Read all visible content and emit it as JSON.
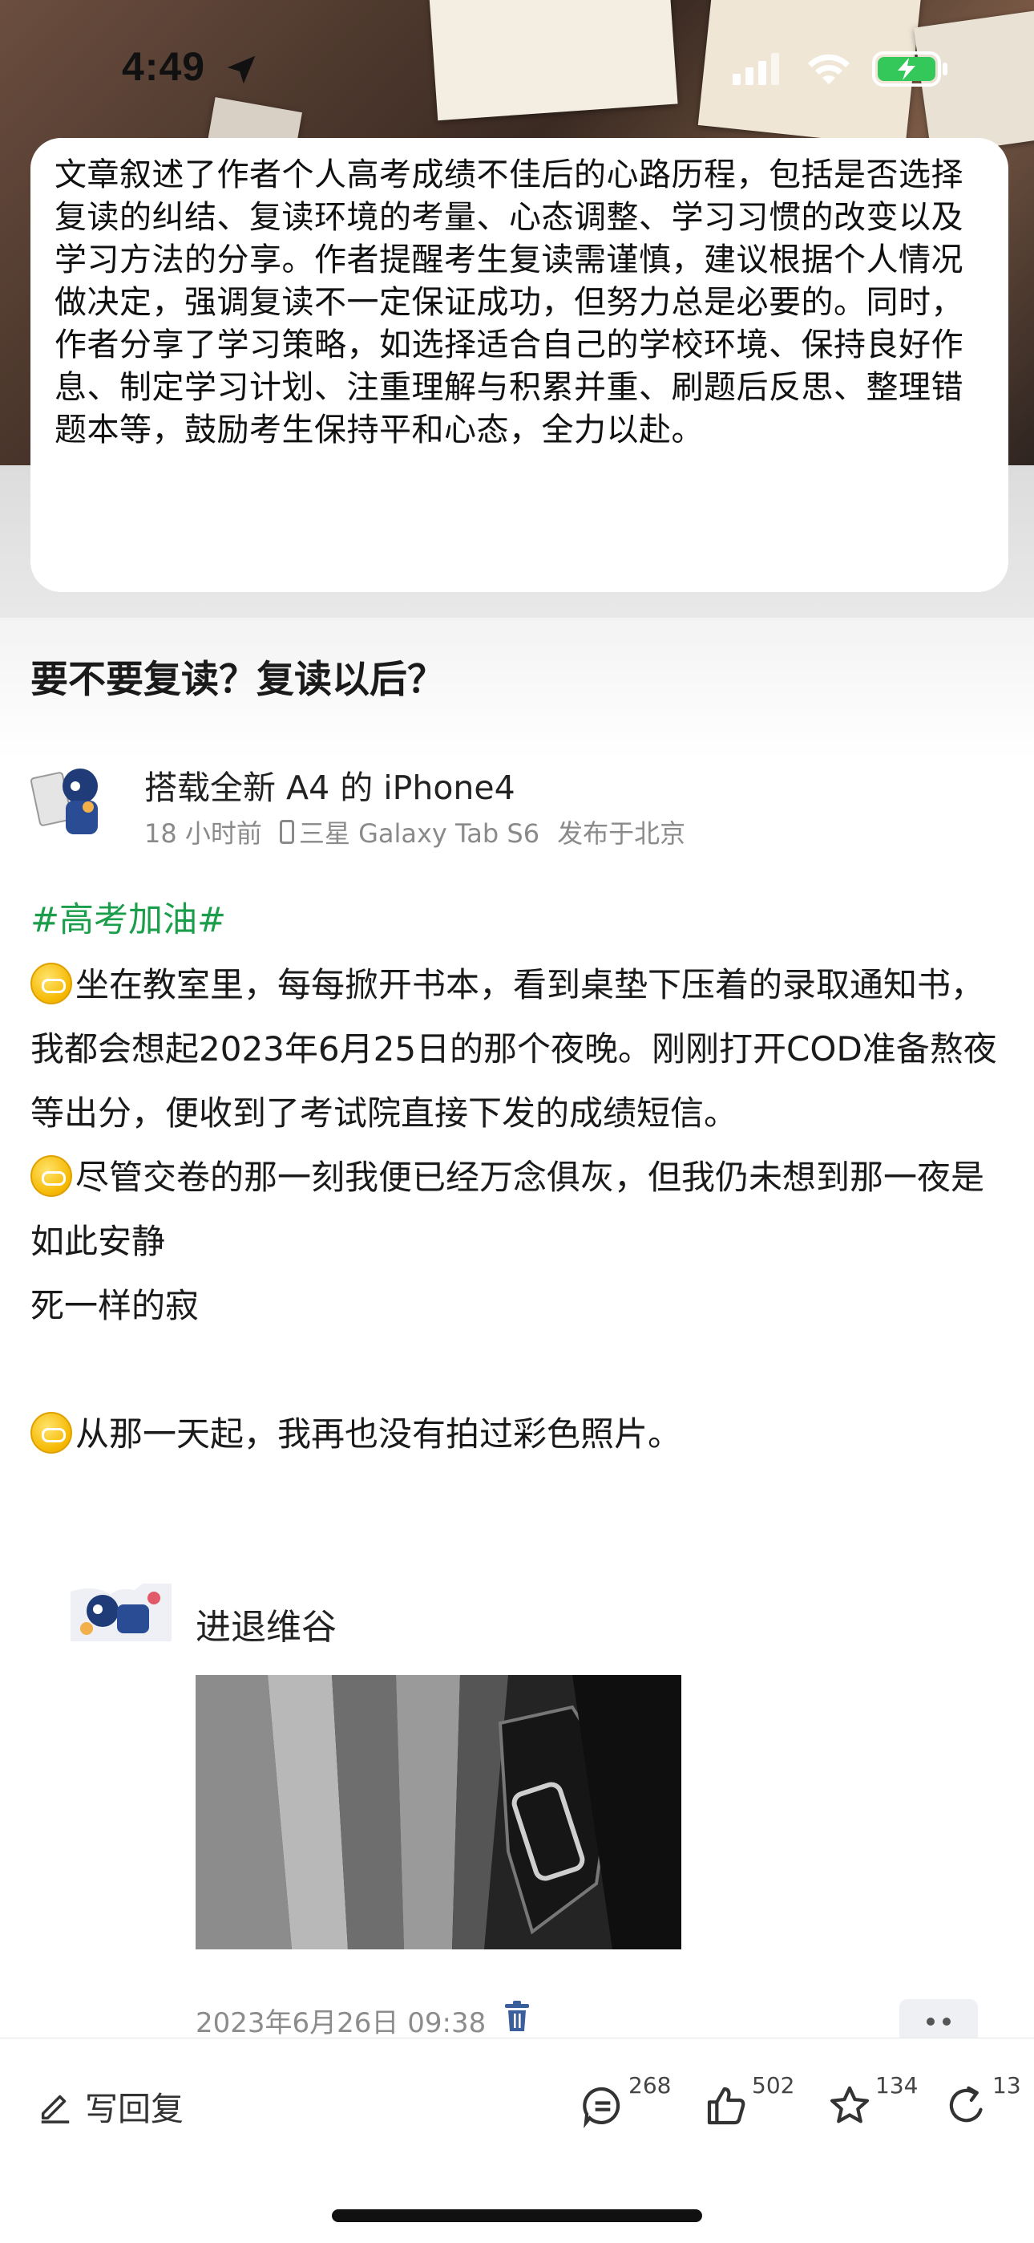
{
  "status_bar": {
    "time": "4:49"
  },
  "summary": {
    "text": "文章叙述了作者个人高考成绩不佳后的心路历程，包括是否选择复读的纠结、复读环境的考量、心态调整、学习习惯的改变以及学习方法的分享。作者提醒考生复读需谨慎，建议根据个人情况做决定，强调复读不一定保证成功，但努力总是必要的。同时，作者分享了学习策略，如选择适合自己的学校环境、保持良好作息、制定学习计划、注重理解与积累并重、刷题后反思、整理错题本等，鼓励考生保持平和心态，全力以赴。"
  },
  "article": {
    "title": "要不要复读？复读以后？",
    "author": {
      "name": "搭载全新 A4 的 iPhone4",
      "time": "18 小时前",
      "device": "三星 Galaxy Tab S6",
      "location": "发布于北京"
    },
    "topic": "#高考加油#",
    "paragraphs": [
      "坐在教室里，每每掀开书本，看到桌垫下压着的录取通知书，我都会想起2023年6月25日的那个夜晚。刚刚打开COD准备熬夜等出分，便收到了考试院直接下发的成绩短信。",
      "尽管交卷的那一刻我便已经万念俱灰，但我仍未想到那一夜是如此安静",
      "死一样的寂",
      "从那一天起，我再也没有拍过彩色照片。"
    ],
    "quote": {
      "name": "进退维谷",
      "date": "2023年6月26日 09:38"
    }
  },
  "bottom_bar": {
    "reply_label": "写回复",
    "comments": "268",
    "likes": "502",
    "favorites": "134",
    "shares": "13"
  },
  "colors": {
    "topic_green": "#1b9e4b",
    "coin_gold": "#f5b800"
  }
}
